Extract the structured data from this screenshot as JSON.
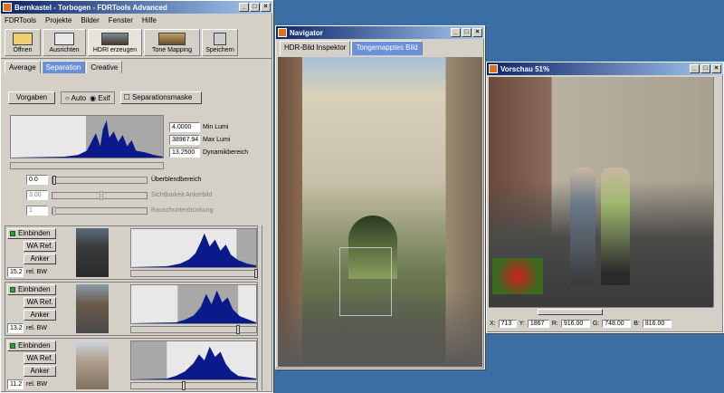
{
  "main_window": {
    "title": "Bernkastel - Torbogen - FDRTools Advanced",
    "menu": [
      "FDRTools",
      "Projekte",
      "Bilder",
      "Fenster",
      "Hilfe"
    ],
    "toolbar": {
      "open": "Öffnen",
      "align": "Ausrichten",
      "hdri": "HDRI erzeugen",
      "tonemap": "Tone Mapping",
      "save": "Speichern"
    },
    "tabs": [
      "Average",
      "Separation",
      "Creative"
    ],
    "active_tab": "Separation",
    "defaults_btn": "Vorgaben",
    "radio_auto": "Auto",
    "radio_exif": "Exif",
    "sep_mask": "Separationsmaske",
    "min_lumi_val": "4.0000",
    "min_lumi_lbl": "Min Lumi",
    "max_lumi_val": "38967.94",
    "max_lumi_lbl": "Max Lumi",
    "dyn_val": "13.2500",
    "dyn_lbl": "Dynamikbereich",
    "blend_val": "0.0",
    "blend_lbl": "Überblendbereich",
    "vis_val": "3.00",
    "vis_lbl": "Sichtbarkeit Ankerbild",
    "noise_val": "1",
    "noise_lbl": "Rauschunterdrückung",
    "layers": [
      {
        "include": "Einbinden",
        "wa_ref": "WA Ref.",
        "anchor": "Anker",
        "ev": "15.2",
        "ev_lbl": "rel. BW",
        "slider_val": "0"
      },
      {
        "include": "Einbinden",
        "wa_ref": "WA Ref.",
        "anchor": "Anker",
        "ev": "13.2",
        "ev_lbl": "rel. BW",
        "slider_val": "0"
      },
      {
        "include": "Einbinden",
        "wa_ref": "WA Ref.",
        "anchor": "Anker",
        "ev": "11.2",
        "ev_lbl": "rel. BW",
        "slider_val": "0"
      }
    ]
  },
  "navigator": {
    "title": "Navigator",
    "tab1": "HDR-Bild Inspektor",
    "tab2": "Tongemapptes Bild"
  },
  "preview": {
    "title": "Vorschau 51%",
    "x_lbl": "X:",
    "x_val": "713",
    "y_lbl": "Y:",
    "y_val": "1867",
    "r_lbl": "R:",
    "r_val": "916.00",
    "g_lbl": "G:",
    "g_val": "748.00",
    "b_lbl": "B:",
    "b_val": "816.00"
  }
}
